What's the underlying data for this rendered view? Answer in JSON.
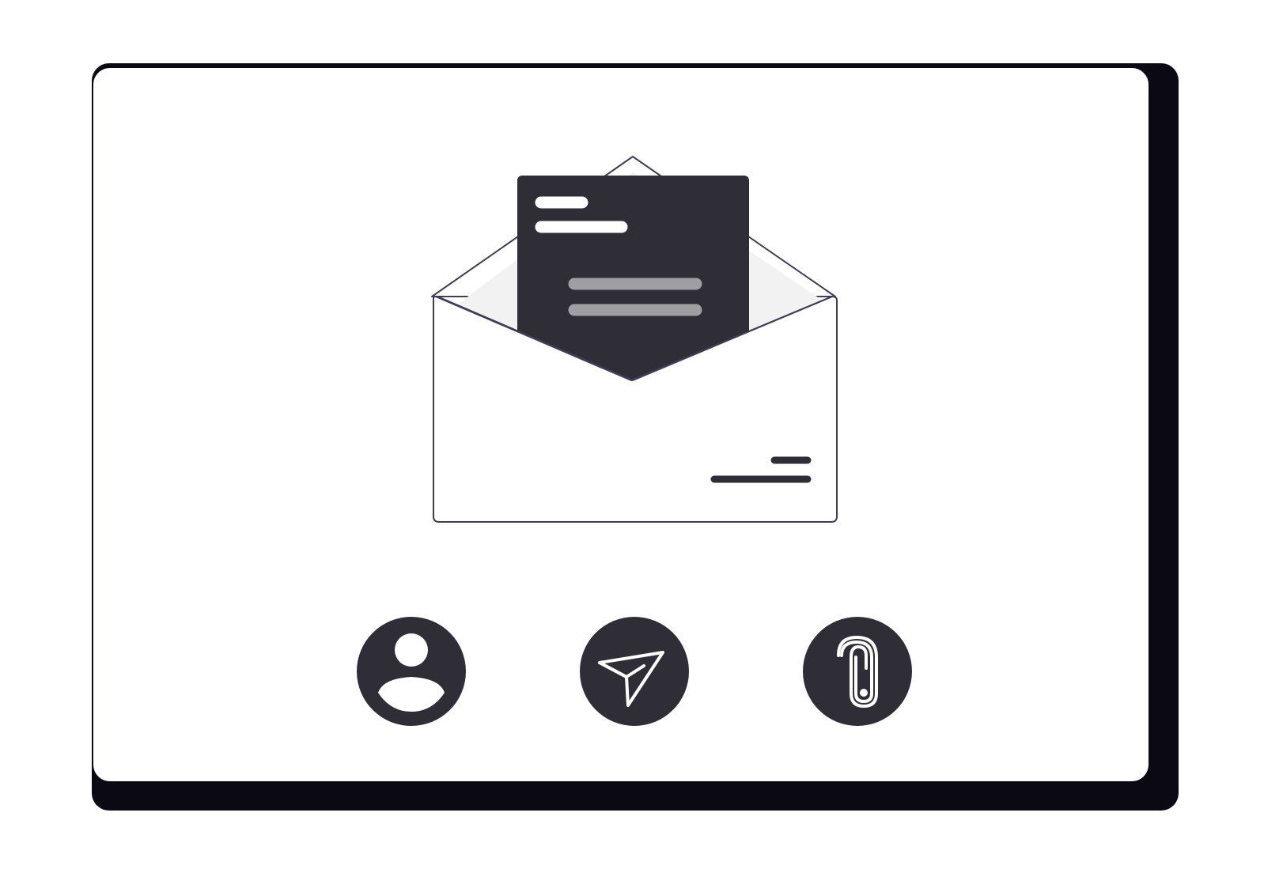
{
  "colors": {
    "background": "#ffffff",
    "window_shadow": "#0b0a14",
    "window_fill": "#ffffff",
    "outline": "#3f3d56",
    "dark": "#2f2e37",
    "flap_shade": "#f2f2f2",
    "bar_light": "#ffffff",
    "bar_gray": "#9e9ea3",
    "icon_stroke": "#ffffff"
  },
  "window": {
    "kind": "email-illustration-window"
  },
  "letter": {
    "lines": [
      "short-line",
      "long-line",
      "gray-line-1",
      "gray-line-2"
    ]
  },
  "envelope": {
    "address_lines": [
      "short-address-line",
      "long-address-line"
    ]
  },
  "actions": [
    {
      "id": "contact",
      "icon": "user-icon"
    },
    {
      "id": "send",
      "icon": "paper-plane-icon"
    },
    {
      "id": "attach",
      "icon": "paperclip-icon"
    }
  ]
}
